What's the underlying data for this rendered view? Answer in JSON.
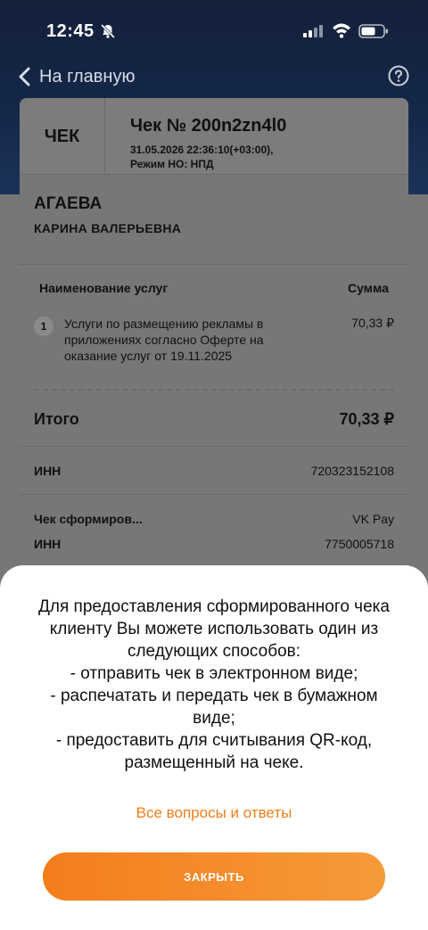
{
  "status_bar": {
    "time": "12:45"
  },
  "nav": {
    "back_label": "На главную"
  },
  "receipt": {
    "header_label": "ЧЕК",
    "number": "Чек № 200n2zn4l0",
    "datetime": "31.05.2026 22:36:10(+03:00),",
    "mode": "Режим НО: НПД",
    "name_last": "АГАЕВА",
    "name_rest": "КАРИНА ВАЛЕРЬЕВНА",
    "col_name": "Наименование услуг",
    "col_sum": "Сумма",
    "items": [
      {
        "num": "1",
        "name": "Услуги по размещению рекламы в приложениях согласно Оферте на оказание услуг от 19.11.2025",
        "sum": "70,33 ₽"
      }
    ],
    "total_label": "Итого",
    "total_value": "70,33 ₽",
    "inn_label": "ИНН",
    "inn_value": "720323152108",
    "generated_label": "Чек сформиров...",
    "generated_value": "VK Pay",
    "inn2_label": "ИНН",
    "inn2_value": "7750005718"
  },
  "sheet": {
    "text": "Для предоставления сформированного чека клиенту Вы можете использовать один из следующих способов:\n- отправить чек в электронном виде;\n- распечатать и передать чек в бумажном виде;\n- предоставить для считывания QR-код, размещенный на чеке.",
    "faq_link": "Все вопросы и ответы",
    "close_button": "ЗАКРЫТЬ"
  },
  "colors": {
    "accent": "#F47D1C",
    "header_bg": "#13203A",
    "sheet_bg": "#FFFFFF"
  }
}
